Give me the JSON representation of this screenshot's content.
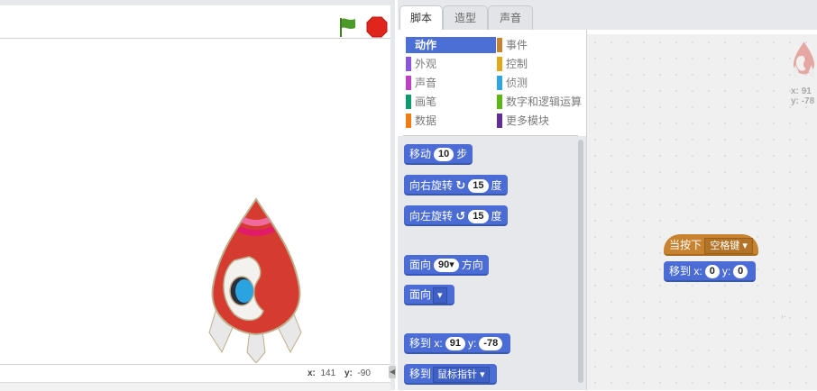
{
  "tabs": [
    "脚本",
    "造型",
    "声音"
  ],
  "categories": [
    {
      "label": "动作",
      "color": "#4c6fd6"
    },
    {
      "label": "外观",
      "color": "#8a55d7"
    },
    {
      "label": "声音",
      "color": "#bb42c3"
    },
    {
      "label": "画笔",
      "color": "#0e9a6c"
    },
    {
      "label": "数据",
      "color": "#ee7d16"
    },
    {
      "label": "事件",
      "color": "#c88330"
    },
    {
      "label": "控制",
      "color": "#e1a91a"
    },
    {
      "label": "侦测",
      "color": "#2ca5e2"
    },
    {
      "label": "数字和逻辑运算",
      "color": "#5cb712"
    },
    {
      "label": "更多模块",
      "color": "#632d99"
    }
  ],
  "selected_category": "动作",
  "palette_blocks": {
    "move": {
      "label": "移动",
      "value": "10",
      "suffix": "步"
    },
    "turn_right": {
      "label": "向右旋转",
      "icon": "↻",
      "value": "15",
      "suffix": "度"
    },
    "turn_left": {
      "label": "向左旋转",
      "icon": "↺",
      "value": "15",
      "suffix": "度"
    },
    "point_direction": {
      "label": "面向",
      "value": "90▾",
      "suffix": "方向"
    },
    "point_towards": {
      "label": "面向",
      "value": "▾"
    },
    "goto_xy": {
      "label": "移到",
      "x_label": "x:",
      "x": "91",
      "y_label": "y:",
      "y": "-78"
    },
    "goto_target": {
      "label": "移到",
      "value": "鼠标指针"
    }
  },
  "script": {
    "hat": {
      "label": "当按下",
      "key": "空格键"
    },
    "goto": {
      "label": "移到",
      "x_label": "x:",
      "x": "0",
      "y_label": "y:",
      "y": "0"
    }
  },
  "stage_coords": {
    "x_label": "x:",
    "x": "141",
    "y_label": "y:",
    "y": "-90"
  },
  "sprite_coords": {
    "x_label": "x:",
    "x": "91",
    "y_label": "y:",
    "y": "-78"
  },
  "icons": {
    "flag": "green-flag-icon",
    "stop": "stop-icon",
    "sprite": "rocket-sprite"
  },
  "colors": {
    "motion": "#4a6cd4",
    "events": "#c88330",
    "flag": "#4c9a2a",
    "stop": "#e0261c"
  }
}
